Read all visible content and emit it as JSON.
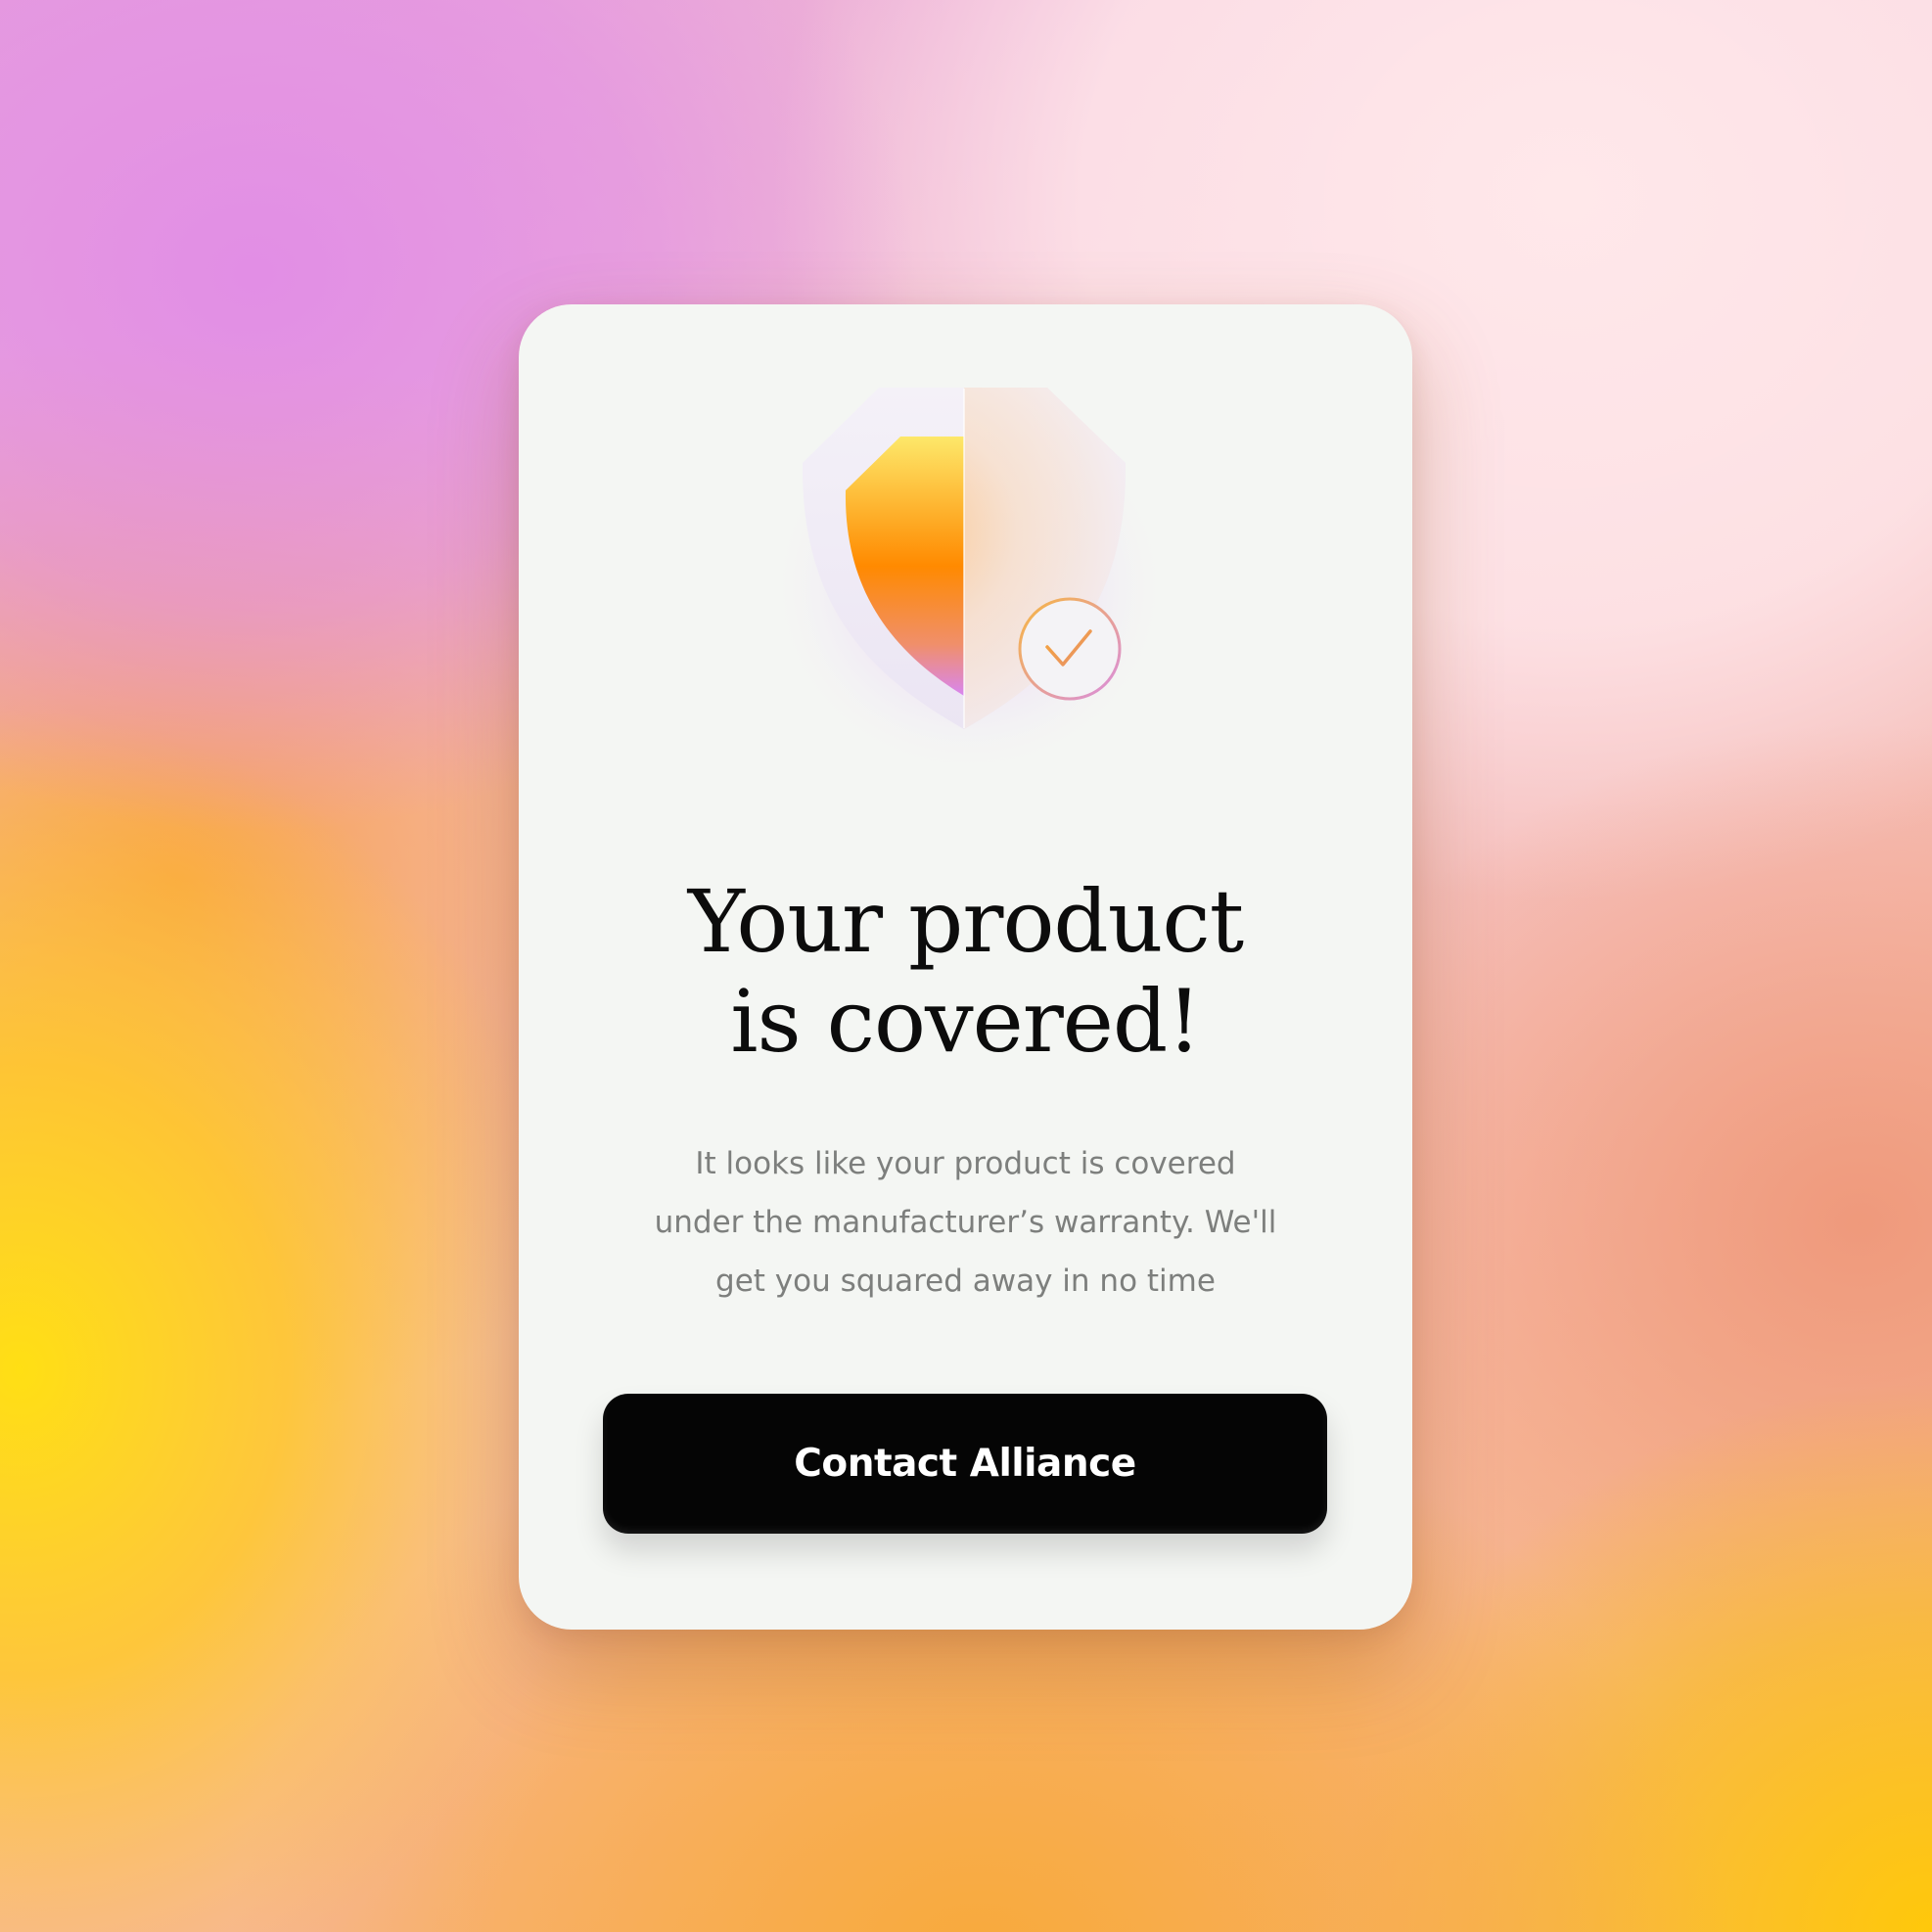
{
  "background": {
    "colors": [
      "#e296df",
      "#ffe01a",
      "#f6a43c",
      "#ffe6e8"
    ]
  },
  "card": {
    "illustration": {
      "icon": "shield-check-icon",
      "colors": {
        "shield_gradient_top": "#fde86a",
        "shield_gradient_mid": "#ff8a00",
        "shield_gradient_bottom": "#d886f0",
        "check_badge_stroke": "#f2a43a"
      }
    },
    "title_line1": "Your product",
    "title_line2": "is covered!",
    "description_line1": "It looks like your product is covered",
    "description_line2": "under the manufacturer’s warranty. We'll",
    "description_line3": "get you squared away in no time",
    "cta_label": "Contact Alliance",
    "cta_color": "#050505"
  }
}
